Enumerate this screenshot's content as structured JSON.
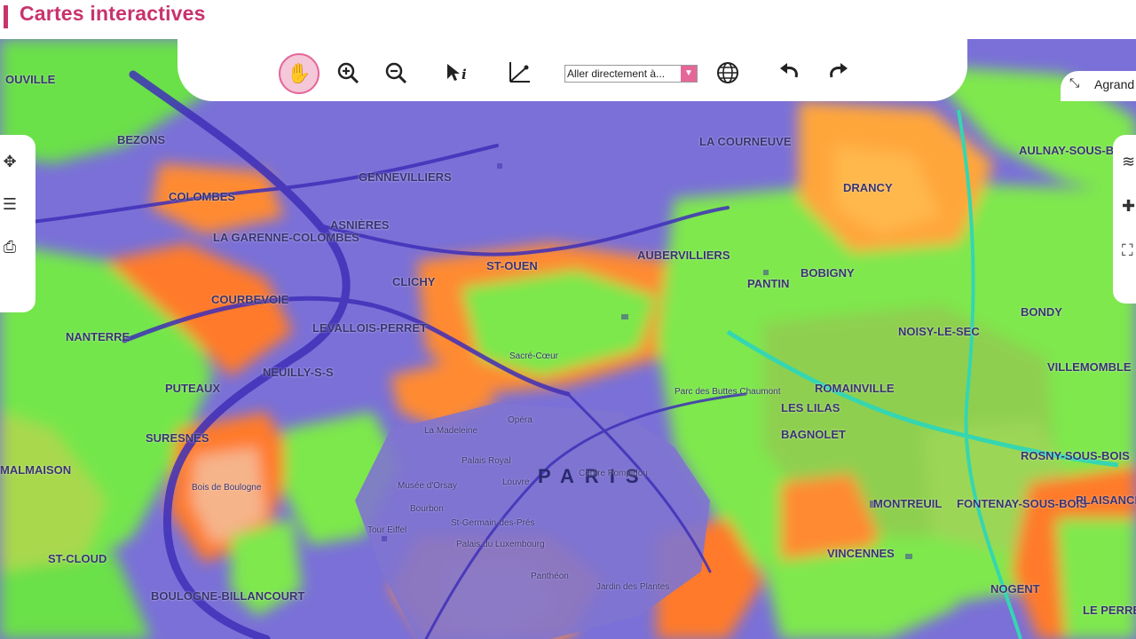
{
  "header": {
    "title": "Cartes interactives"
  },
  "toolbar": {
    "goto_placeholder": "Aller directement à...",
    "agrandir_label": "Agrand"
  },
  "colors": {
    "accent": "#c8336c",
    "active_tool_bg": "#f4c7d9",
    "active_tool_border": "#e5679a",
    "map_base": "#7a70d8"
  },
  "icons": {
    "pan": "hand-icon",
    "zoom_in": "zoom-in-icon",
    "zoom_out": "zoom-out-icon",
    "info": "info-pointer-icon",
    "measure": "measure-icon",
    "globe": "globe-icon",
    "undo": "undo-icon",
    "redo": "redo-icon",
    "expand": "expand-icon",
    "move": "move-icon",
    "legend": "list-icon",
    "print": "print-icon",
    "layers": "layers-icon",
    "add": "add-icon",
    "select": "select-icon"
  },
  "map": {
    "center_label": "PARIS",
    "places": [
      "OUVILLE",
      "BEZONS",
      "GENNEVILLIERS",
      "LA COURNEUVE",
      "COLOMBES",
      "ASNIÈRES",
      "ST-OUEN",
      "AUBERVILLIERS",
      "PANTIN",
      "BOBIGNY",
      "AULNAY-SOUS-BOIS",
      "DRANCY",
      "BONDY",
      "CLICHY",
      "LA GARENNE-COLOMBES",
      "COURBEVOIE",
      "LEVALLOIS-PERRET",
      "NANTERRE",
      "PUTEAUX",
      "NEUILLY-S-S",
      "NOISY-LE-SEC",
      "ROMAINVILLE",
      "VILLEMOMBLE",
      "LES LILAS",
      "BAGNOLET",
      "SURESNES",
      "MALMAISON",
      "ROSNY-SOUS-BOIS",
      "MONTREUIL",
      "FONTENAY-SOUS-BOIS",
      "VINCENNES",
      "ST-CLOUD",
      "BOULOGNE-BILLANCOURT",
      "PLAISANCE",
      "NOGENT",
      "LE PERREUX-S-MARNE",
      "Opéra",
      "La Madeleine",
      "Palais Royal",
      "Louvre",
      "Centre Pompidou",
      "Musée d'Orsay",
      "Bourbon",
      "Tour Eiffel",
      "St-Germain-des-Prés",
      "Palais du Luxembourg",
      "Panthéon",
      "Jardin des Plantes",
      "Bois de Boulogne",
      "Parc des Buttes Chaumont",
      "Sacré-Cœur"
    ]
  }
}
